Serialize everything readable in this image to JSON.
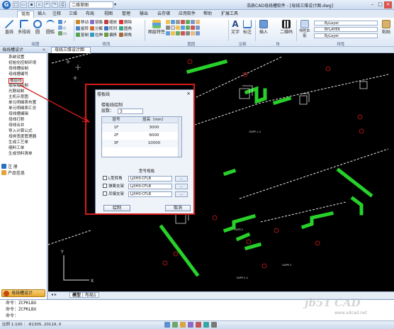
{
  "app": {
    "title": "浩辰CAD母线槽软件 - [母线三维设计图.dwg]",
    "drawing_combo": "二维草图",
    "quick_access": [
      "新建",
      "打开",
      "保存",
      "另存",
      "撤销",
      "重做",
      "打印"
    ]
  },
  "menu_tabs": [
    "常用",
    "插入",
    "注释",
    "三维",
    "布局",
    "视图",
    "管理",
    "输出",
    "云存储",
    "应用软件",
    "帮助",
    "扩展工具"
  ],
  "active_tab": "常用",
  "ribbon": {
    "draw": {
      "line": "直线",
      "polyline": "多段线",
      "circle": "圆",
      "arc": "圆弧"
    },
    "modify": {
      "items": [
        "移动",
        "旋转",
        "复制",
        "镜像",
        "分解",
        "拉伸",
        "缩放",
        "阵列",
        "偏移",
        "删除",
        "圆角",
        "倒角"
      ]
    },
    "annotation": {
      "text": "文字",
      "dim": "标注"
    },
    "layer": {
      "props": "图层特性"
    },
    "insert": {
      "label": "插入",
      "qrcode": "二维码"
    },
    "clipboard": {
      "paste": "粘贴"
    },
    "match": {
      "label": "特性匹配"
    },
    "layer_combo": [
      "ByLayer",
      "BYLAYER",
      "ByLayer"
    ],
    "group_labels": [
      "绘图",
      "修改",
      "注释",
      "图层",
      "块",
      "特性"
    ]
  },
  "left_panel": {
    "title": "母线槽设计",
    "menu_items": [
      "系统设置",
      "初始化控制环境",
      "母线槽绘制",
      "母线槽编号",
      "楼层线",
      "插接箱绘制",
      "光联绘制",
      "主机示意图",
      "单元明细表布置",
      "单元明细表汇总",
      "母线槽编辑",
      "母线打断",
      "母线合并",
      "导入计算公式",
      "母排宽度管理器",
      "生成工艺单",
      "缩料工单",
      "生成领料清单"
    ],
    "selected_index": 4,
    "tree": [
      "注 册",
      "产品信息"
    ],
    "footer": "母线槽设计"
  },
  "doc_tab": "母线三维设计图",
  "layout_tabs": [
    "模型",
    "布局1"
  ],
  "dialog": {
    "title": "楼板线",
    "section": "楼板线绘制",
    "floors_label": "层数：",
    "floors_value": "3",
    "columns": [
      "层号",
      "层高（mm）"
    ],
    "rows": [
      [
        "1F",
        "3000"
      ],
      [
        "2F",
        "6000"
      ],
      [
        "3F",
        "10000"
      ]
    ],
    "spec_title": "型号规格",
    "checks": [
      {
        "label": "L型转角",
        "spec": "LJXH0-CFLB"
      },
      {
        "label": "弹簧支架",
        "spec": "LJXH0-CFLB"
      },
      {
        "label": "吊爆支架",
        "spec": "LJXH0-CFLB"
      }
    ],
    "draw_button": "绘制",
    "cancel_button": "取消"
  },
  "canvas": {
    "labels": [
      "1WPP-1-4",
      "1WPP-2",
      "1WPP-2-4",
      "2WPP-2"
    ]
  },
  "command": {
    "lines": [
      "命令：ZCPKLBX",
      "命令：ZCPKLBX",
      "命令："
    ]
  },
  "status": {
    "coords": "比例 1:100 ：-81305, 20119, 0"
  },
  "watermark": {
    "text": "jb51 CAD",
    "url": "www.xdcad.net"
  },
  "colors": {
    "pipe": "#28d12a",
    "annotation": "#d61b1b",
    "canvas_bg": "#000000",
    "accent": "#2a6fc2"
  }
}
